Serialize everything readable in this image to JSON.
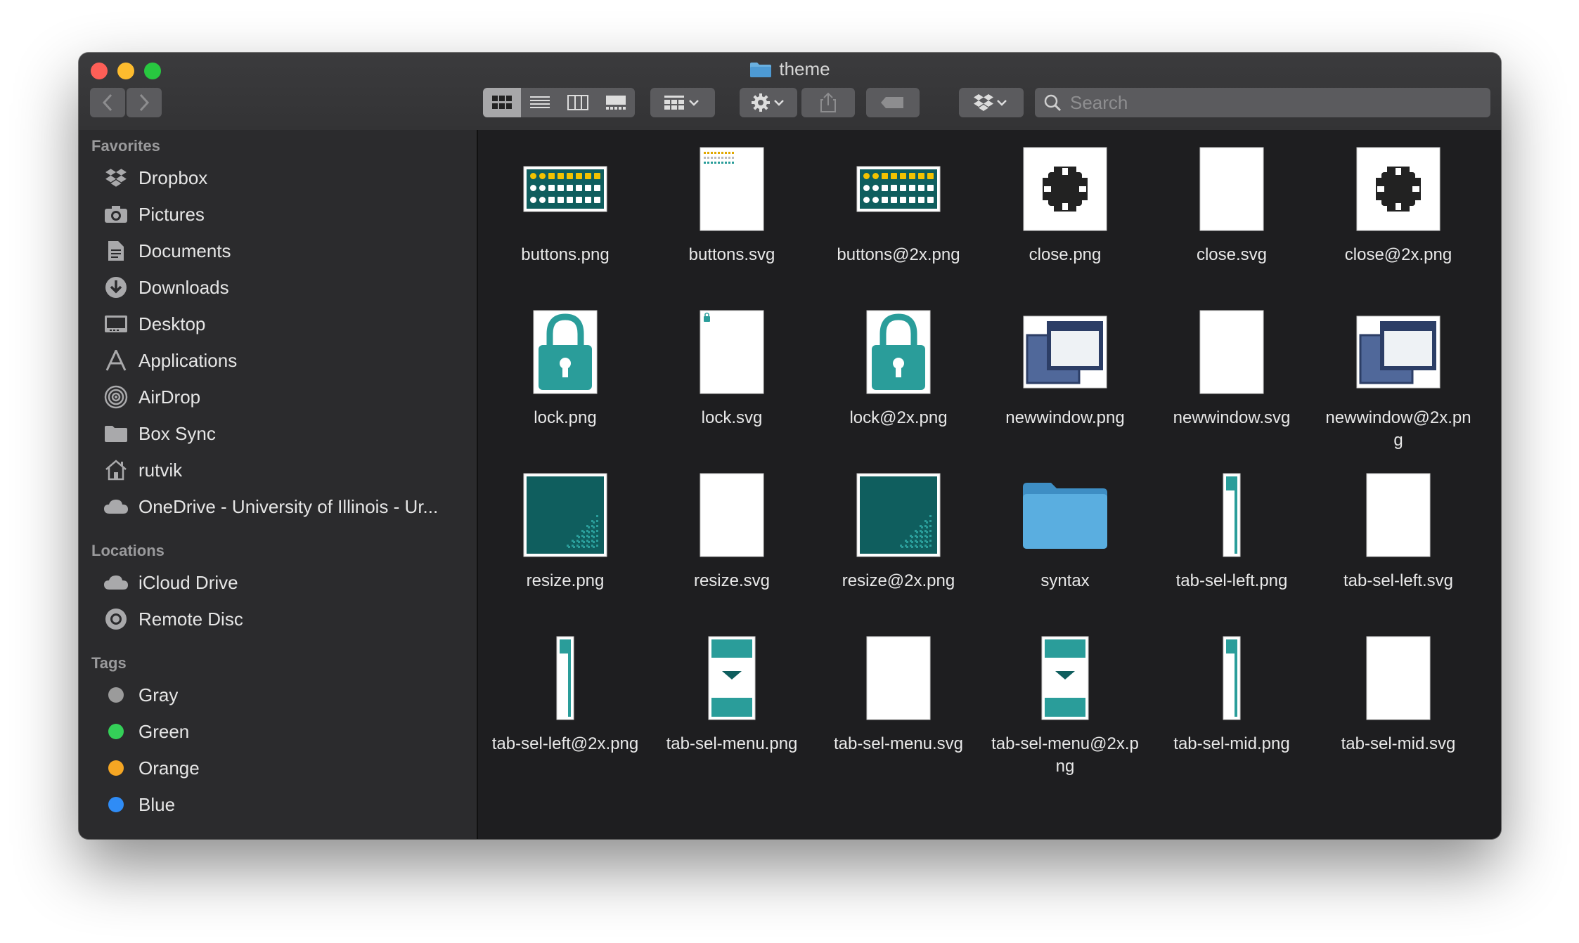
{
  "window": {
    "title": "theme"
  },
  "toolbar": {
    "search_placeholder": "Search"
  },
  "sidebar": {
    "favorites_header": "Favorites",
    "favorites": [
      {
        "label": "Dropbox",
        "icon": "dropbox-icon"
      },
      {
        "label": "Pictures",
        "icon": "camera-icon"
      },
      {
        "label": "Documents",
        "icon": "documents-icon"
      },
      {
        "label": "Downloads",
        "icon": "downloads-icon"
      },
      {
        "label": "Desktop",
        "icon": "desktop-icon"
      },
      {
        "label": "Applications",
        "icon": "applications-icon"
      },
      {
        "label": "AirDrop",
        "icon": "airdrop-icon"
      },
      {
        "label": "Box Sync",
        "icon": "folder-icon"
      },
      {
        "label": "rutvik",
        "icon": "home-icon"
      },
      {
        "label": "OneDrive - University of Illinois - Ur...",
        "icon": "cloud-icon"
      }
    ],
    "locations_header": "Locations",
    "locations": [
      {
        "label": "iCloud Drive",
        "icon": "cloud-icon"
      },
      {
        "label": "Remote Disc",
        "icon": "disc-icon"
      }
    ],
    "tags_header": "Tags",
    "tags": [
      {
        "label": "Gray",
        "color": "#9b9b9b"
      },
      {
        "label": "Green",
        "color": "#34d058"
      },
      {
        "label": "Orange",
        "color": "#f5a623"
      },
      {
        "label": "Blue",
        "color": "#2f8cf6"
      }
    ]
  },
  "files": [
    {
      "name": "buttons.png",
      "thumb": "buttons"
    },
    {
      "name": "buttons.svg",
      "thumb": "page-dots"
    },
    {
      "name": "buttons@2x.png",
      "thumb": "buttons"
    },
    {
      "name": "close.png",
      "thumb": "close"
    },
    {
      "name": "close.svg",
      "thumb": "blank"
    },
    {
      "name": "close@2x.png",
      "thumb": "close"
    },
    {
      "name": "lock.png",
      "thumb": "lock"
    },
    {
      "name": "lock.svg",
      "thumb": "page-lock"
    },
    {
      "name": "lock@2x.png",
      "thumb": "lock"
    },
    {
      "name": "newwindow.png",
      "thumb": "newwindow"
    },
    {
      "name": "newwindow.svg",
      "thumb": "blank"
    },
    {
      "name": "newwindow@2x.png",
      "thumb": "newwindow"
    },
    {
      "name": "resize.png",
      "thumb": "resize"
    },
    {
      "name": "resize.svg",
      "thumb": "blank"
    },
    {
      "name": "resize@2x.png",
      "thumb": "resize"
    },
    {
      "name": "syntax",
      "thumb": "folder"
    },
    {
      "name": "tab-sel-left.png",
      "thumb": "tab-strip"
    },
    {
      "name": "tab-sel-left.svg",
      "thumb": "blank"
    },
    {
      "name": "tab-sel-left@2x.png",
      "thumb": "tab-strip"
    },
    {
      "name": "tab-sel-menu.png",
      "thumb": "tab-menu"
    },
    {
      "name": "tab-sel-menu.svg",
      "thumb": "blank"
    },
    {
      "name": "tab-sel-menu@2x.png",
      "thumb": "tab-menu"
    },
    {
      "name": "tab-sel-mid.png",
      "thumb": "tab-strip"
    },
    {
      "name": "tab-sel-mid.svg",
      "thumb": "blank"
    }
  ],
  "colors": {
    "teal": "#2a9d9a",
    "dark_teal": "#0f5e5e",
    "navy": "#2c3e66"
  }
}
